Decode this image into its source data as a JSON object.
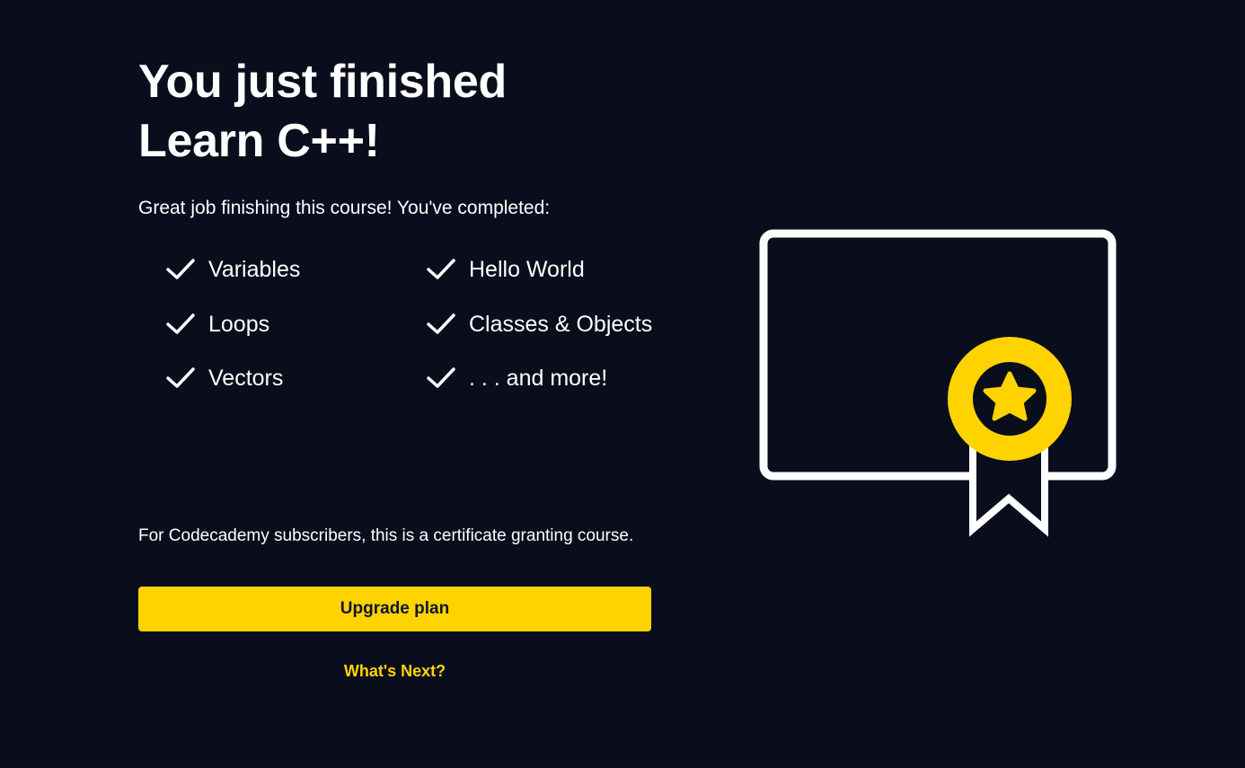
{
  "heading": {
    "line1": "You just finished",
    "line2": "Learn C++!"
  },
  "subtitle": "Great job finishing this course! You've completed:",
  "completed_items": [
    "Variables",
    "Hello World",
    "Loops",
    "Classes & Objects",
    "Vectors",
    ". . . and more!"
  ],
  "certificate_note": "For Codecademy subscribers, this is a certificate granting course.",
  "upgrade_button_label": "Upgrade plan",
  "whats_next_label": "What's Next?",
  "icons": {
    "completed_item": "check-icon",
    "illustration": "certificate-icon",
    "badge": "star-icon"
  },
  "colors": {
    "background": "#0a0d1c",
    "accent": "#ffd300",
    "text": "#ffffff",
    "button_text": "#10162f"
  }
}
